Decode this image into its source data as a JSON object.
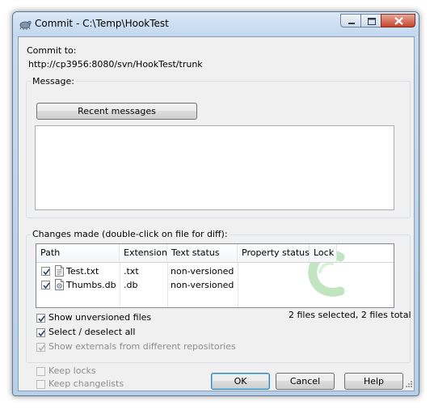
{
  "window": {
    "title": "Commit - C:\\Temp\\HookTest"
  },
  "commit": {
    "label": "Commit to:",
    "url": "http://cp3956:8080/svn/HookTest/trunk"
  },
  "message": {
    "group_label": "Message:",
    "recent_button": "Recent messages",
    "text": ""
  },
  "changes": {
    "group_label": "Changes made (double-click on file for diff):",
    "columns": [
      "Path",
      "Extension",
      "Text status",
      "Property status",
      "Lock"
    ],
    "rows": [
      {
        "checked": true,
        "icon": "text-file-icon",
        "path": "Test.txt",
        "extension": ".txt",
        "text_status": "non-versioned",
        "property_status": "",
        "lock": ""
      },
      {
        "checked": true,
        "icon": "database-file-icon",
        "path": "Thumbs.db",
        "extension": ".db",
        "text_status": "non-versioned",
        "property_status": "",
        "lock": ""
      }
    ],
    "summary": "2 files selected, 2 files total",
    "options": [
      {
        "label": "Show unversioned files",
        "checked": true,
        "enabled": true
      },
      {
        "label": "Select / deselect all",
        "checked": true,
        "enabled": true
      },
      {
        "label": "Show externals from different repositories",
        "checked": true,
        "enabled": false
      }
    ]
  },
  "footer": {
    "keep_locks": {
      "label": "Keep locks",
      "checked": false,
      "enabled": false
    },
    "keep_changelists": {
      "label": "Keep changelists",
      "checked": false,
      "enabled": false
    },
    "ok_button": "OK",
    "cancel_button": "Cancel",
    "help_button": "Help"
  },
  "colors": {
    "title_bar": "#c2d7ef",
    "close_button": "#c8432a",
    "dialog_background": "#f0f0f0",
    "default_button_border": "#3c7fb1",
    "watermark": "#8ed08e"
  }
}
